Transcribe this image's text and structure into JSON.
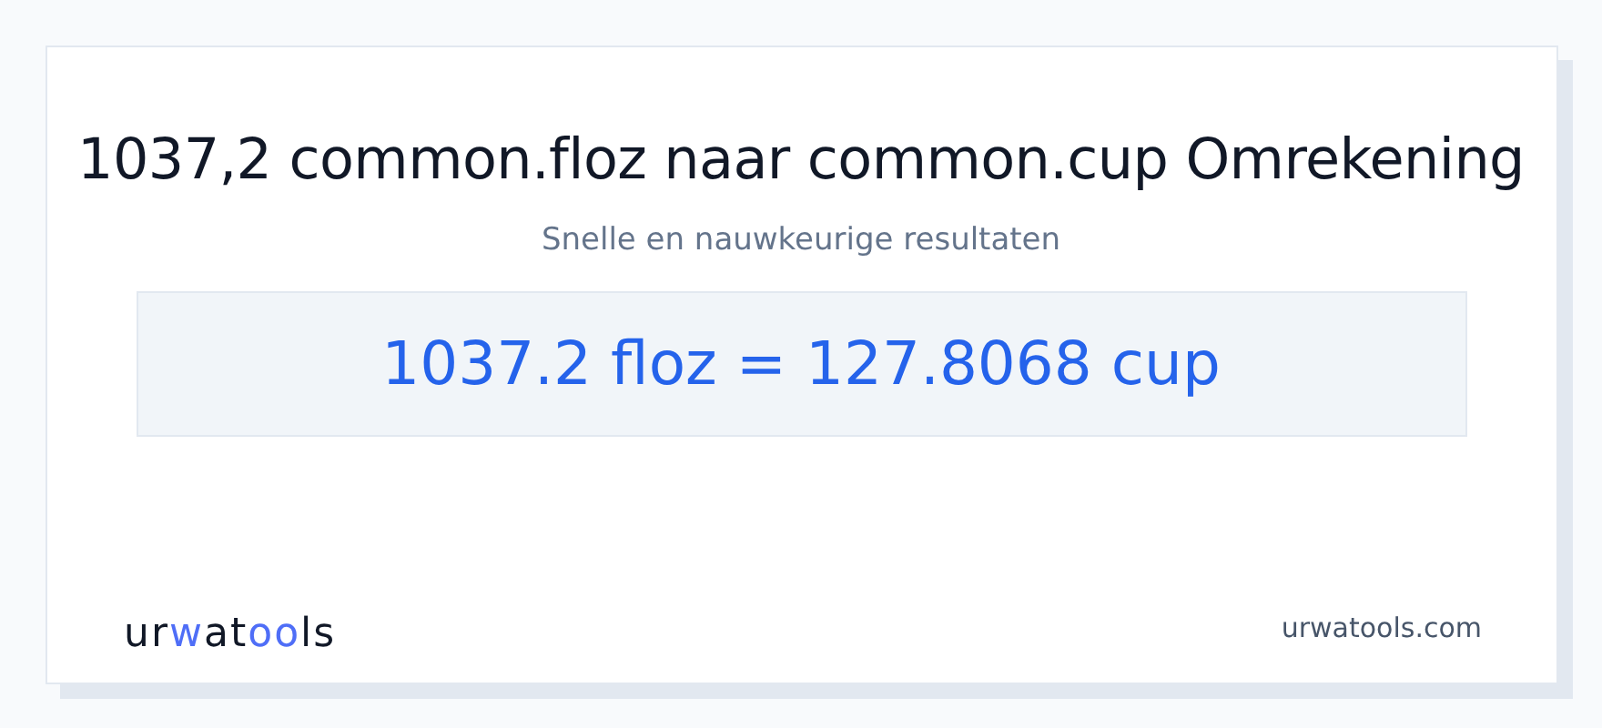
{
  "title": "1037,2 common.floz naar common.cup Omrekening",
  "subtitle": "Snelle en nauwkeurige resultaten",
  "result": "1037.2 floz = 127.8068 cup",
  "logo_parts": [
    {
      "text": "ur",
      "accent": false
    },
    {
      "text": "w",
      "accent": true
    },
    {
      "text": "at",
      "accent": false
    },
    {
      "text": "oo",
      "accent": true
    },
    {
      "text": "ls",
      "accent": false
    }
  ],
  "site": "urwatools.com"
}
